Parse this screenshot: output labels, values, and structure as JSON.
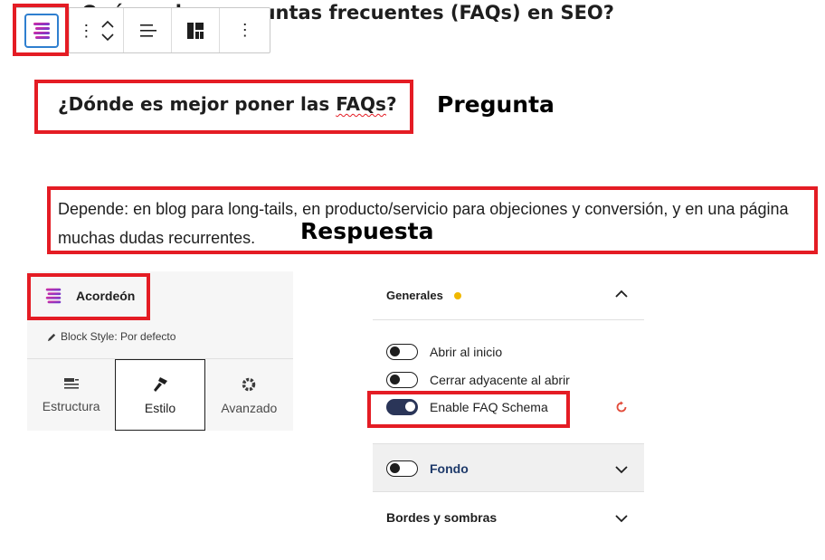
{
  "heading": {
    "text": "¿Qué son las preguntas frecuentes (FAQs) en SEO?"
  },
  "toolbar": {
    "block_icon": "accordion-icon",
    "drag_icon": "drag-handle-icon",
    "move_icons": [
      "chevron-up-icon",
      "chevron-down-icon"
    ],
    "align_icon": "align-left-icon",
    "layout_icon": "layout-grid-icon",
    "more_icon": "more-vertical-icon"
  },
  "question": {
    "before": "¿Dónde es mejor poner las ",
    "spell": "FAQs",
    "after": "?",
    "annotation": "Pregunta"
  },
  "answer": {
    "line1": "Depende: en blog para long-tails, en producto/servicio para objeciones y conversión, y en una página",
    "line2": "muchas dudas recurrentes.",
    "annotation": "Respuesta"
  },
  "block_card": {
    "title": "Acordeón",
    "style_label": "Block Style: Por defecto",
    "tabs": [
      {
        "label": "Estructura",
        "icon": "list-icon",
        "active": false
      },
      {
        "label": "Estilo",
        "icon": "brush-icon",
        "active": true
      },
      {
        "label": "Avanzado",
        "icon": "gear-icon",
        "active": false
      }
    ]
  },
  "settings": {
    "generales": {
      "title": "Generales",
      "toggles": [
        {
          "label": "Abrir al inicio",
          "on": false
        },
        {
          "label": "Cerrar adyacente al abrir",
          "on": false
        },
        {
          "label": "Enable FAQ Schema",
          "on": true
        }
      ]
    },
    "fondo": {
      "title": "Fondo"
    },
    "bordes": {
      "title": "Bordes y sombras"
    }
  },
  "colors": {
    "highlight": "#e41c24",
    "accent_dot": "#f0b800",
    "toggle_on": "#2a3558",
    "reset": "#e24b3a",
    "icon_gradient_start": "#e6299b",
    "icon_gradient_end": "#5b3fd6"
  }
}
